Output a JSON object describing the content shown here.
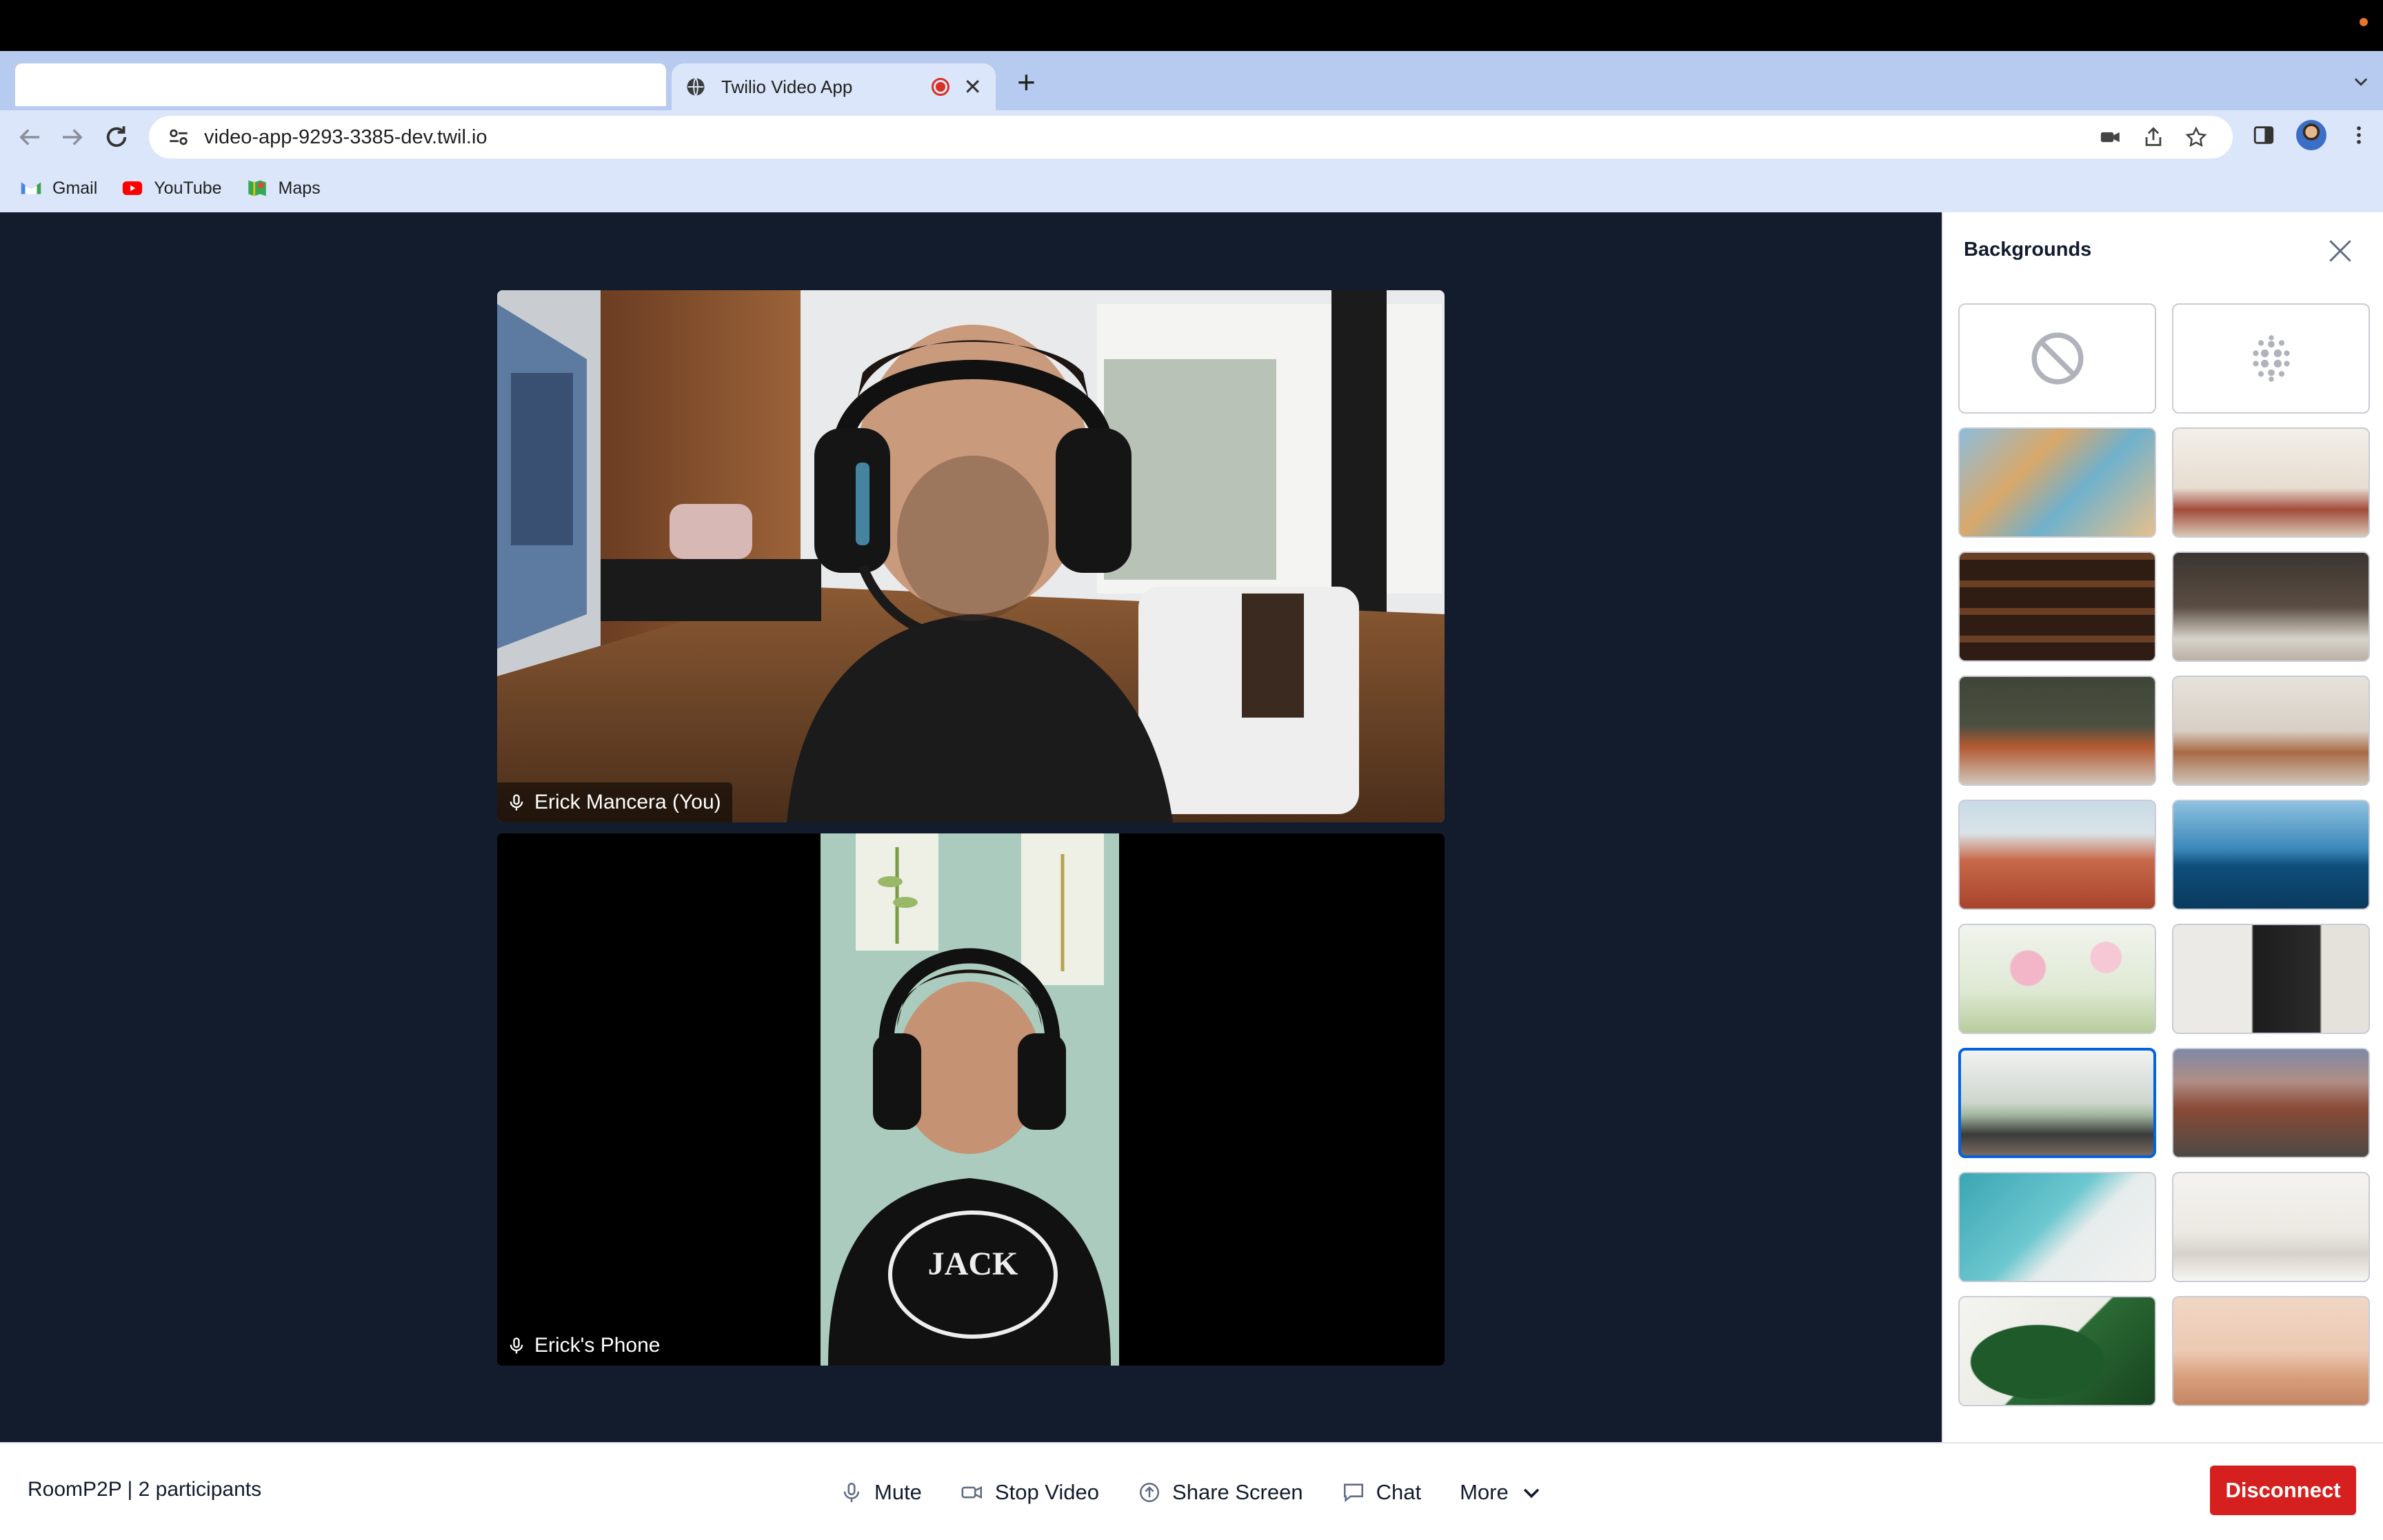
{
  "browser": {
    "tab_title": "Twilio Video App",
    "url": "video-app-9293-3385-dev.twil.io",
    "bookmarks": [
      {
        "label": "Gmail",
        "icon": "gmail-icon"
      },
      {
        "label": "YouTube",
        "icon": "youtube-icon"
      },
      {
        "label": "Maps",
        "icon": "maps-icon"
      }
    ]
  },
  "participants": [
    {
      "name": "Erick Mancera (You)",
      "icon": "microphone-icon"
    },
    {
      "name": "Erick's Phone",
      "icon": "microphone-icon"
    }
  ],
  "backgrounds_panel": {
    "title": "Backgrounds",
    "options": [
      {
        "name": "none",
        "icon": "no-background-icon"
      },
      {
        "name": "blur",
        "icon": "blur-icon"
      },
      {
        "name": "abstract-smoke"
      },
      {
        "name": "living-room"
      },
      {
        "name": "bookshelf"
      },
      {
        "name": "coffee-shop"
      },
      {
        "name": "orange-sofa-room"
      },
      {
        "name": "modern-lounge"
      },
      {
        "name": "desert-dune"
      },
      {
        "name": "ocean-boat"
      },
      {
        "name": "pink-flowers"
      },
      {
        "name": "dark-kitchen"
      },
      {
        "name": "bright-loft",
        "selected": true
      },
      {
        "name": "red-rocks"
      },
      {
        "name": "beach-aerial"
      },
      {
        "name": "white-dining"
      },
      {
        "name": "monstera-leaf"
      },
      {
        "name": "golden-gate"
      }
    ]
  },
  "bottom_bar": {
    "room_info": "RoomP2P | 2 participants",
    "mute_label": "Mute",
    "stop_video_label": "Stop Video",
    "share_screen_label": "Share Screen",
    "chat_label": "Chat",
    "more_label": "More",
    "disconnect_label": "Disconnect"
  },
  "colors": {
    "app_background": "#121c2d",
    "disconnect": "#d6201f",
    "selected_border": "#0263e0",
    "chrome_tabstrip": "#b6cbef"
  }
}
